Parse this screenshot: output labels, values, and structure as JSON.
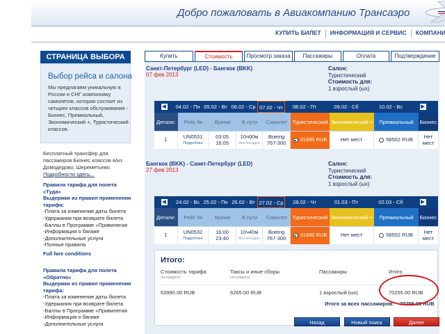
{
  "header": {
    "title": "Добро пожаловать в Авиакомпанию Трансаэро",
    "nav": [
      "КУПИТЬ БИЛЕТ",
      "ИНФОРМАЦИЯ И СЕРВИС",
      "КОМПАНИЯ"
    ]
  },
  "sidebar": {
    "title": "СТРАНИЦА ВЫБОРА",
    "subtitle": "Выбор рейса и салона",
    "description": "Мы предлагаем уникальную в России и СНГ компоновку самолетов, которая состоит из четырех классов обслуживания - Бизнес, Премиальный, Экономический +, Туристический классов.",
    "transfer_text": "Бесплатный трансфер для пассажиров Бизнес классов в/из Домодедово, Шереметьево.",
    "transfer_link": "Подробности здесь...",
    "rules_out": {
      "heading": "Правила тарифа для полета «Туда»",
      "subheading": "Выдержки из правил применения тарифа:",
      "items": [
        "-Плата за изменение даты билета",
        "-Удержания при возврате билета",
        "-Баллы в Программе «Привилегия",
        "-Информация о багаже",
        "-Дополнительные услуги",
        "-Полные правила"
      ],
      "link": "Full fare conditions"
    },
    "rules_back": {
      "heading": "Правила тарифа для полета «Обратно»",
      "subheading": "Выдержки из правил применения тарифа:",
      "items": [
        "-Плата за изменение даты билета",
        "-Удержания при возврате билета",
        "-Баллы в Программе «Привилегия",
        "-Информация о багаже",
        "-Дополнительные услуги"
      ]
    }
  },
  "tabs": [
    "Купить",
    "Стоимость",
    "Просмотр заказа",
    "Пассажиры",
    "Оплата",
    "Подтверждение"
  ],
  "active_tab": "Стоимость",
  "outbound": {
    "route": "Санкт-Петербург (LED) - Бангкок (BKK)",
    "date": "07 фев 2013",
    "salon_label": "Салон:",
    "salon_value": "Туристический",
    "cost_label": "Стоимость для:",
    "cost_value": "1 взрослый (ых)",
    "dates": [
      "04.02 - Пн",
      "05.02 - Вт",
      "06.02 - Ср",
      "07.02 - Чт",
      "08.02 - Пт",
      "09.02 - Сб",
      "10.02 - Вс"
    ],
    "selected_date": "07.02 - Чт",
    "head": {
      "details": "Детали:",
      "flight": "Рейс №",
      "time": "Время",
      "duration": "В пути",
      "plane": "Самолет",
      "tourist": "Туристический",
      "economy": "Экономический +",
      "premium": "Премиальный",
      "business": "Бизнес"
    },
    "row": {
      "num": "1",
      "flight": "UN0531",
      "more": "Подробнее",
      "dep": "03:05",
      "arr": "16:05",
      "duration": "10ч00м",
      "stops": "без посадок",
      "plane": "Boeing 767-300",
      "tourist_price": "31695 RUB",
      "economy": "Нет мест",
      "premium_price": "58502 RUB",
      "business": "Нет мест"
    }
  },
  "inbound": {
    "route": "Бангкок (BKK) - Санкт-Петербург (LED)",
    "date": "27 фев 2013",
    "salon_label": "Салон:",
    "salon_value": "Туристический",
    "cost_label": "Стоимость для:",
    "cost_value": "1 взрослый (ых)",
    "dates": [
      "24.02 - Вс",
      "25.02 - Пн",
      "26.02 - Вт",
      "27.02 - Ср",
      "28.02 - Чт",
      "01.03 - Пт",
      "02.03 - Сб"
    ],
    "selected_date": "27.02 - Ср",
    "head": {
      "details": "Детали:",
      "flight": "Рейс №",
      "time": "Время",
      "duration": "В пути",
      "plane": "Самолет",
      "tourist": "Туристический",
      "economy": "Экономический +",
      "premium": "Премиальный",
      "business": "Бизнес"
    },
    "row": {
      "num": "1",
      "flight": "UN0532",
      "more": "Подробнее",
      "dep": "16:00",
      "arr": "23:40",
      "duration": "10ч40м",
      "stops": "без посадок",
      "plane": "Boeing 767-300",
      "tourist_price": "31695 RUB",
      "economy": "Нет мест",
      "premium_price": "58502 RUB",
      "business": "Нет мест"
    }
  },
  "totals": {
    "title": "Итого:",
    "col_fare": "Стоимость тарифа",
    "col_fare_sub": "(за каждого)",
    "col_taxes": "Таксы и иные сборы",
    "col_taxes_sub": "(за каждого)",
    "col_pax": "Пассажиры",
    "col_total": "Итого",
    "fare": "63990.00 RUB",
    "taxes": "6265.00 RUB",
    "pax": "1 взрослый (ых)",
    "total": "70255.00 RUB",
    "grand_label": "Итого за всех пассажиров:",
    "grand_value": "70255.00 RUB"
  },
  "buttons": {
    "back": "Назад",
    "new_search": "Новый поиск",
    "next": "Далее"
  },
  "colors": {
    "brand_blue": "#0e4a92",
    "tourist_orange": "#f26b1a",
    "economy_yellow": "#e7c21e",
    "premium_blue": "#1f6fc5",
    "annotation_red": "#d61a1a"
  }
}
